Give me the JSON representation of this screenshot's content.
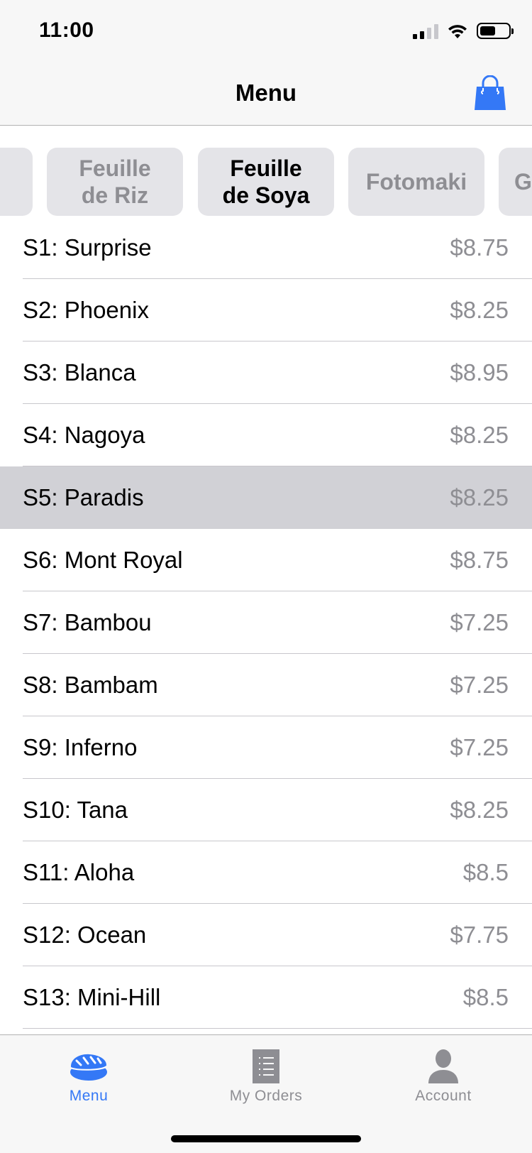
{
  "status_bar": {
    "time": "11:00",
    "icons": [
      "cellular-signal-icon",
      "wifi-icon",
      "battery-icon"
    ],
    "battery_level": 0.55
  },
  "nav": {
    "title": "Menu",
    "cart_icon": "shopping-bag-icon",
    "accent_color": "#3478f6"
  },
  "categories": [
    {
      "label": "",
      "active": false
    },
    {
      "label": "Feuille\nde Riz",
      "active": false
    },
    {
      "label": "Feuille\nde Soya",
      "active": true
    },
    {
      "label": "Fotomaki",
      "active": false
    },
    {
      "label": "G",
      "active": false
    }
  ],
  "menu_items": [
    {
      "name": "S1: Surprise",
      "price": "$8.75"
    },
    {
      "name": "S2: Phoenix",
      "price": "$8.25"
    },
    {
      "name": "S3: Blanca",
      "price": "$8.95"
    },
    {
      "name": "S4: Nagoya",
      "price": "$8.25"
    },
    {
      "name": "S5: Paradis",
      "price": "$8.25",
      "selected": true
    },
    {
      "name": "S6: Mont Royal",
      "price": "$8.75"
    },
    {
      "name": "S7: Bambou",
      "price": "$7.25"
    },
    {
      "name": "S8: Bambam",
      "price": "$7.25"
    },
    {
      "name": "S9: Inferno",
      "price": "$7.25"
    },
    {
      "name": "S10: Tana",
      "price": "$8.25"
    },
    {
      "name": "S11: Aloha",
      "price": "$8.5"
    },
    {
      "name": "S12: Ocean",
      "price": "$7.75"
    },
    {
      "name": "S13: Mini-Hill",
      "price": "$8.5"
    }
  ],
  "tabs": [
    {
      "label": "Menu",
      "icon": "sushi-icon",
      "active": true
    },
    {
      "label": "My Orders",
      "icon": "order-list-icon",
      "active": false
    },
    {
      "label": "Account",
      "icon": "account-person-icon",
      "active": false
    }
  ]
}
